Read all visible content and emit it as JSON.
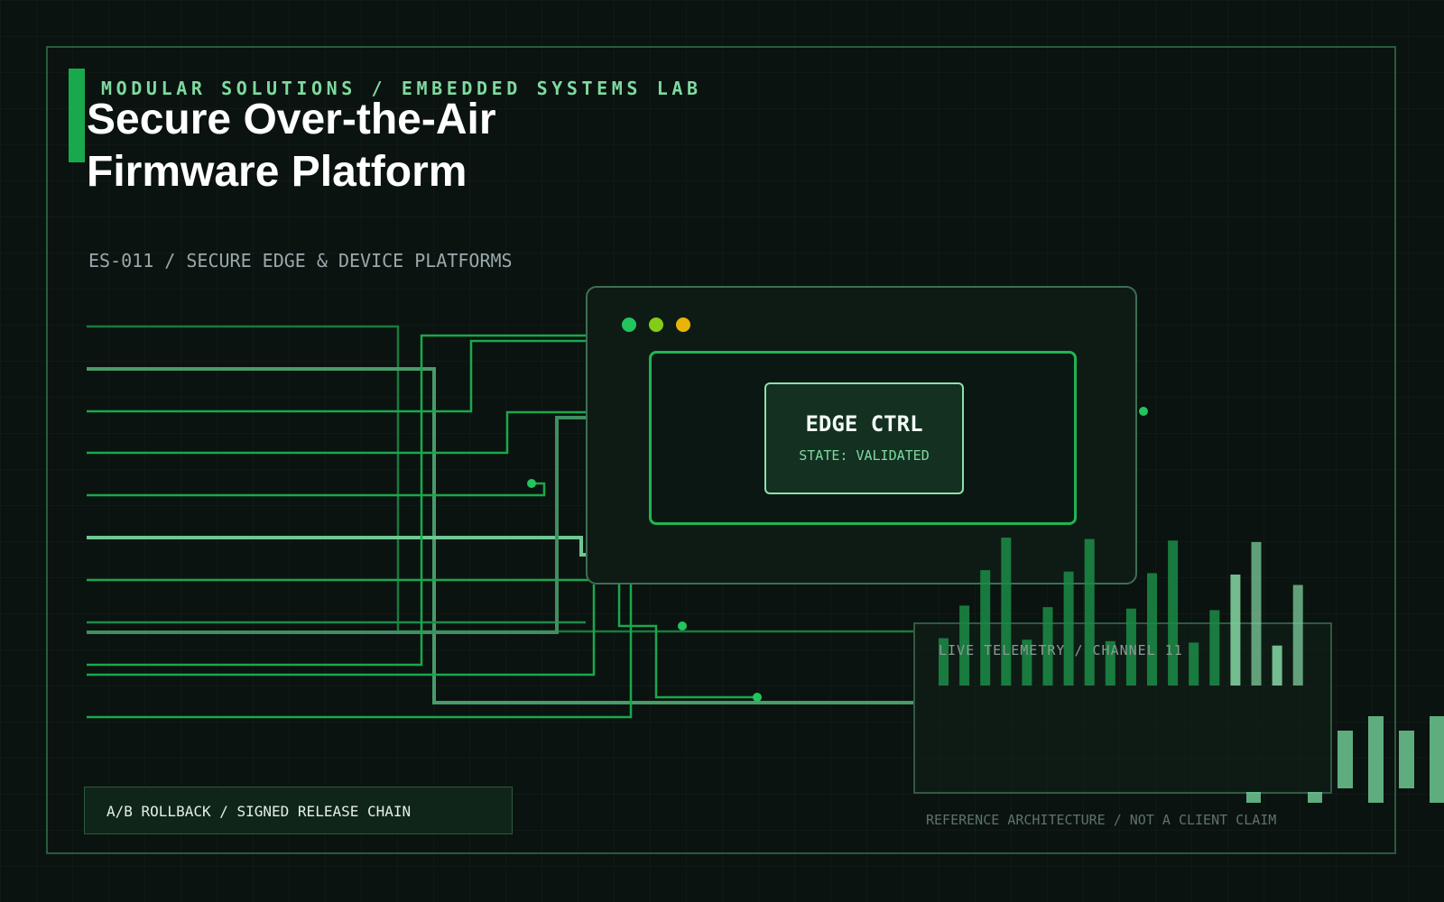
{
  "eyebrow": "MODULAR SOLUTIONS / EMBEDDED SYSTEMS LAB",
  "title_line_1": "Secure Over-the-Air",
  "title_line_2": "Firmware Platform",
  "subtitle": "ES-011 / SECURE EDGE & DEVICE PLATFORMS",
  "device": {
    "title": "EDGE CTRL",
    "state": "STATE: VALIDATED",
    "window_dot_colors": [
      "#22c55e",
      "#84cc16",
      "#eab308"
    ]
  },
  "telemetry": {
    "label": "LIVE TELEMETRY / CHANNEL 11",
    "bar_levels": [
      0.32,
      0.54,
      0.78,
      1.0,
      0.31,
      0.53,
      0.77,
      0.99,
      0.3,
      0.52,
      0.76,
      0.98,
      0.29,
      0.51,
      0.75,
      0.97,
      0.27,
      0.68
    ]
  },
  "footer": {
    "badge": "A/B ROLLBACK / SIGNED RELEASE CHAIN",
    "note": "REFERENCE ARCHITECTURE / NOT A CLIENT CLAIM"
  },
  "colors": {
    "background": "#0a130f",
    "accent": "#1aa84c",
    "accent_light": "#7fd9a0",
    "trace": "#1aa84c",
    "trace_light": "#6fc893"
  }
}
